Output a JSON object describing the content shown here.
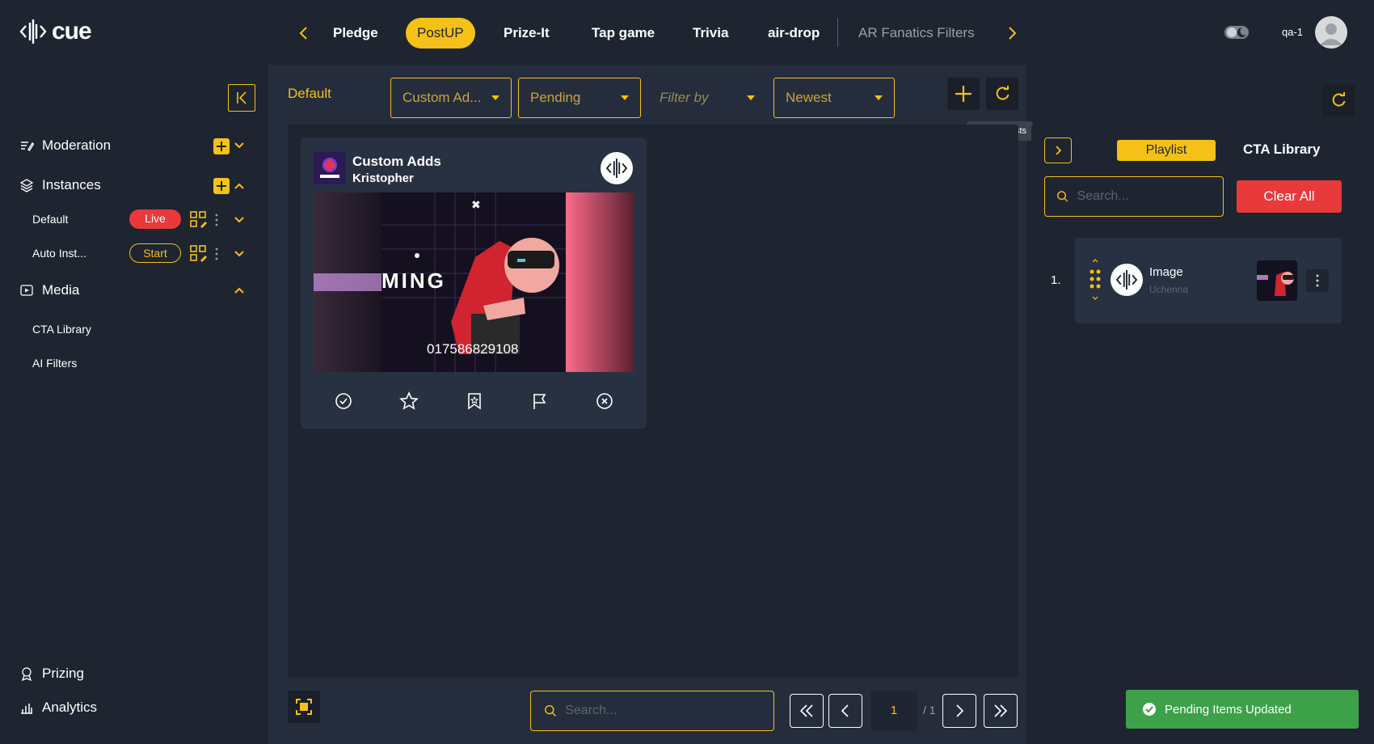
{
  "app": {
    "logo_text": "cue"
  },
  "header": {
    "tabs": [
      {
        "label": "Pledge",
        "active": false
      },
      {
        "label": "PostUP",
        "active": true
      },
      {
        "label": "Prize-It",
        "active": false
      },
      {
        "label": "Tap game",
        "active": false
      },
      {
        "label": "Trivia",
        "active": false
      },
      {
        "label": "air-drop",
        "active": false
      },
      {
        "label": "AR Fanatics Filters",
        "active": false
      }
    ],
    "user_name": "qa-1"
  },
  "sidebar": {
    "moderation": "Moderation",
    "instances": "Instances",
    "instance_items": [
      {
        "label": "Default",
        "status": "Live"
      },
      {
        "label": "Auto Inst...",
        "status": "Start"
      }
    ],
    "media": "Media",
    "media_items": [
      "CTA Library",
      "AI Filters"
    ],
    "prizing": "Prizing",
    "analytics": "Analytics"
  },
  "main": {
    "section_label": "Default",
    "filters": [
      {
        "label": "Custom Ad...",
        "placeholder": false
      },
      {
        "label": "Pending",
        "placeholder": false
      },
      {
        "label": "Filter by",
        "placeholder": true
      },
      {
        "label": "Newest",
        "placeholder": false
      }
    ],
    "tooltip": "Update Posts",
    "card": {
      "title": "Custom Adds",
      "user": "Kristopher",
      "overlay_number": "017586829108",
      "media_text": "MING"
    },
    "bottom_search_placeholder": "Search...",
    "page_current": "1",
    "page_total": "/ 1"
  },
  "right_panel": {
    "tabs": {
      "playlist": "Playlist",
      "cta": "CTA Library"
    },
    "search_placeholder": "Search...",
    "clear_all": "Clear All",
    "items": [
      {
        "index": "1.",
        "title": "Image",
        "subtitle": "Uchenna"
      }
    ]
  },
  "toast": {
    "message": "Pending Items Updated"
  },
  "colors": {
    "accent": "#f5c116",
    "danger": "#e83a3a",
    "success": "#3da14a",
    "bg": "#1e2430",
    "panel": "#252d3c"
  }
}
